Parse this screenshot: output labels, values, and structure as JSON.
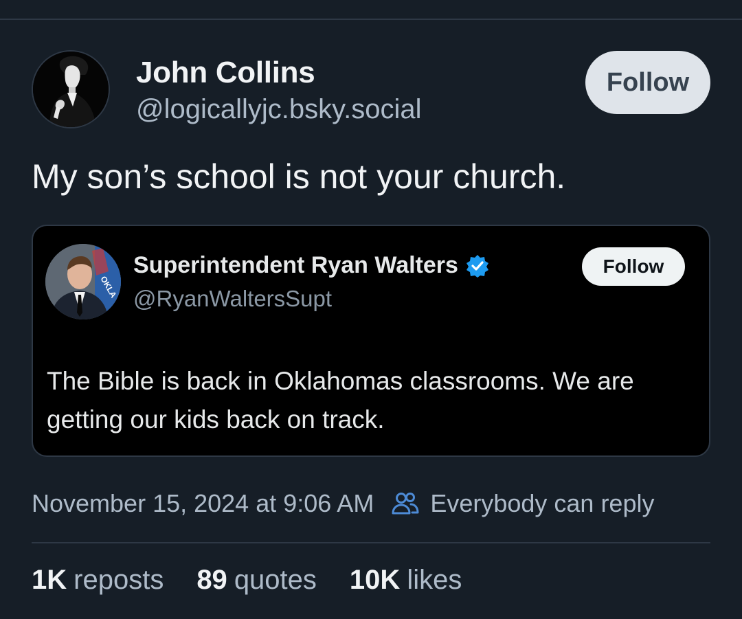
{
  "post": {
    "author_name": "John Collins",
    "author_handle": "@logicallyjc.bsky.social",
    "follow_label": "Follow",
    "text": "My son’s school is not your church.",
    "timestamp": "November 15, 2024 at 9:06 AM",
    "reply_setting": "Everybody can reply"
  },
  "quote": {
    "author_name": "Superintendent Ryan Walters",
    "author_handle": "@RyanWaltersSupt",
    "follow_label": "Follow",
    "text": "The Bible is back in Oklahomas classrooms.  We are getting our kids back on track.",
    "avatar_flag_text": "OKLA"
  },
  "stats": {
    "reposts_count": "1K",
    "reposts_label": "reposts",
    "quotes_count": "89",
    "quotes_label": "quotes",
    "likes_count": "10K",
    "likes_label": "likes"
  },
  "colors": {
    "background": "#161e27",
    "card_background": "#000000",
    "divider": "#2e3845",
    "secondary_text": "#aebbc9",
    "verified_badge": "#1d9bf0",
    "follow_button": "#dfe4ea"
  },
  "icons": {
    "verified": "verified-badge-icon",
    "reply_setting": "people-icon"
  }
}
